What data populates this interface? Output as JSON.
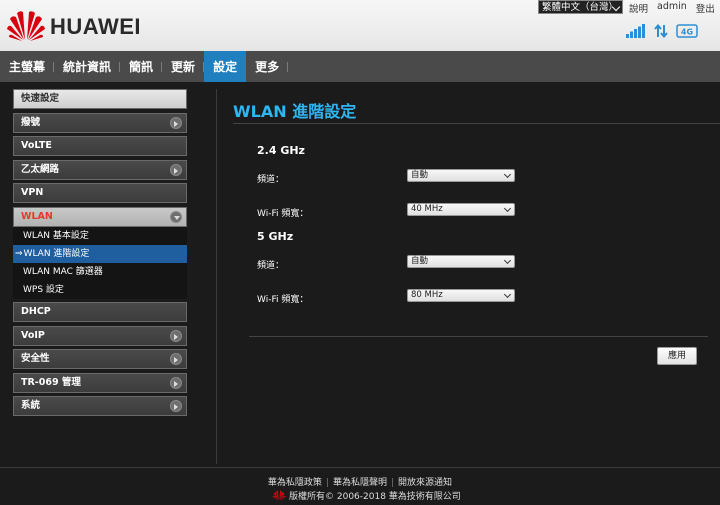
{
  "header": {
    "brand": "HUAWEI",
    "language": "繁體中文（台灣）",
    "links": [
      "說明",
      "admin",
      "登出"
    ]
  },
  "nav": {
    "items": [
      "主螢幕",
      "統計資訊",
      "簡訊",
      "更新",
      "設定",
      "更多"
    ],
    "active_index": 4
  },
  "sidebar": {
    "items": [
      "快速設定",
      "撥號",
      "VoLTE",
      "乙太網路",
      "VPN",
      "WLAN",
      "DHCP",
      "VoIP",
      "安全性",
      "TR-069 管理",
      "系統"
    ],
    "wlan_sub": [
      "WLAN 基本設定",
      "WLAN 進階設定",
      "WLAN MAC 篩選器",
      "WPS 設定"
    ],
    "active_sub_arrow": "⇒"
  },
  "main": {
    "title": "WLAN 進階設定",
    "band1": {
      "title": "2.4 GHz",
      "channel_label": "頻道：",
      "channel_value": "自動",
      "bandwidth_label": "Wi-Fi 頻寬：",
      "bandwidth_value": "40 MHz"
    },
    "band2": {
      "title": "5 GHz",
      "channel_label": "頻道：",
      "channel_value": "自動",
      "bandwidth_label": "Wi-Fi 頻寬：",
      "bandwidth_value": "80 MHz"
    },
    "apply_label": "應用"
  },
  "footer": {
    "links": [
      "華為私隱政策",
      "華為私隱聲明",
      "開放來源通知"
    ],
    "copyright": "版權所有© 2006-2018 華為技術有限公司"
  },
  "colors": {
    "accent": "#2eb6f0",
    "nav_active": "#1f7fbf",
    "logo_red": "#d7000f",
    "wlan_label": "#e23a2a"
  },
  "icons": {
    "signal": "signal-strength-icon",
    "data": "data-transfer-icon",
    "network": "4g-network-icon"
  }
}
